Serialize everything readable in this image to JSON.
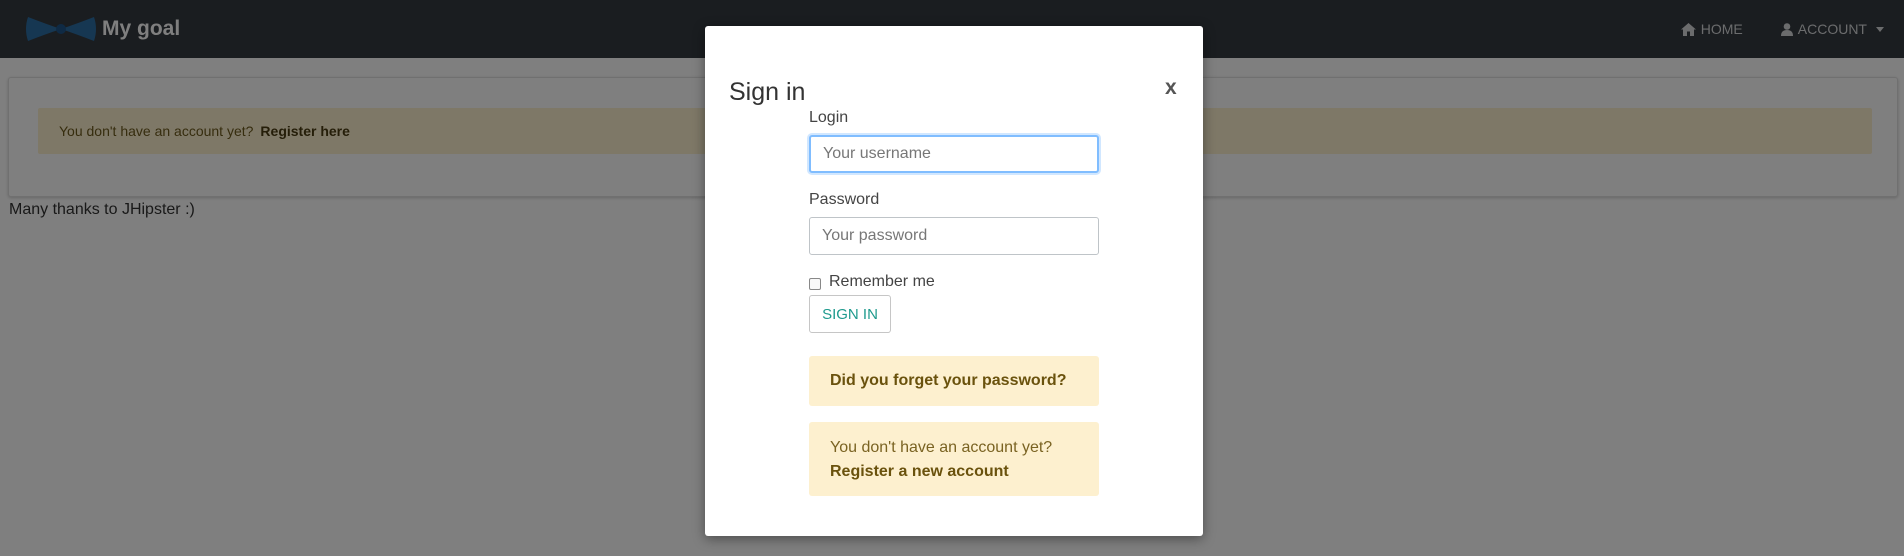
{
  "navbar": {
    "brand_title": "My goal",
    "home_label": "HOME",
    "account_label": "ACCOUNT",
    "background": "#353a40"
  },
  "main": {
    "warning_text": "You don't have an account yet?",
    "register_link": "Register here",
    "footer_text": "Many thanks to JHipster :)"
  },
  "modal": {
    "title": "Sign in",
    "close_label": "x",
    "login_label": "Login",
    "login_placeholder": "Your username",
    "password_label": "Password",
    "password_placeholder": "Your password",
    "remember_label": "Remember me",
    "signin_label": "SIGN IN",
    "forgot_password": "Did you forget your password?",
    "no_account_text": "You don't have an account yet?",
    "register_new": "Register a new account"
  },
  "colors": {
    "alert_background": "#fdf0cf",
    "signin_text": "#1e9a8d",
    "focus_border": "#80bdff"
  },
  "icons": {
    "logo": "bow-tie-logo",
    "home": "home-icon",
    "account": "user-icon",
    "account_dropdown": "caret-down-icon"
  }
}
